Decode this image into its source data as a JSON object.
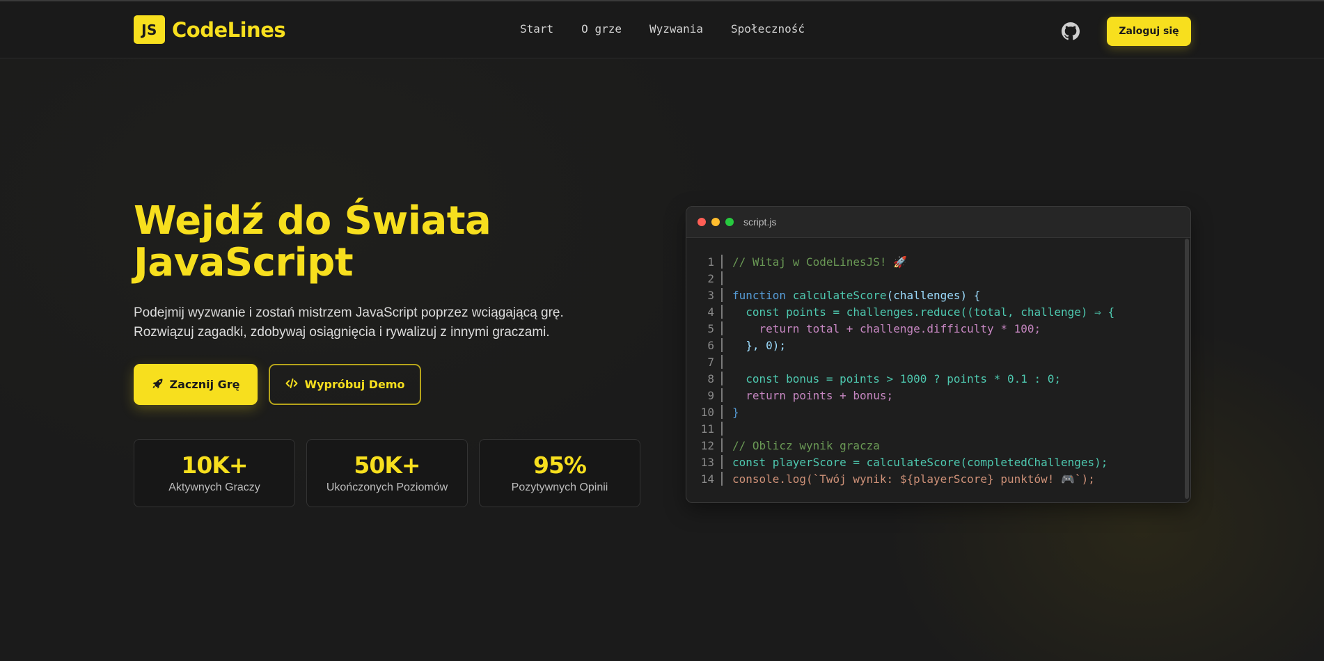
{
  "header": {
    "logo_badge": "JS",
    "logo_text": "CodeLines",
    "nav": [
      "Start",
      "O grze",
      "Wyzwania",
      "Społeczność"
    ],
    "github_icon": "github-icon",
    "login_label": "Zaloguj się"
  },
  "hero": {
    "title_line1": "Wejdź do Świata",
    "title_line2": "JavaScript",
    "subtitle_line1": "Podejmij wyzwanie i zostań mistrzem JavaScript poprzez wciągającą grę.",
    "subtitle_line2": "Rozwiązuj zagadki, zdobywaj osiągnięcia i rywalizuj z innymi graczami.",
    "primary_button": "Zacznij Grę",
    "primary_icon": "rocket-icon",
    "secondary_button": "Wypróbuj Demo",
    "secondary_icon": "code-icon"
  },
  "stats": [
    {
      "value": "10K+",
      "label": "Aktywnych Graczy"
    },
    {
      "value": "50K+",
      "label": "Ukończonych Poziomów"
    },
    {
      "value": "95%",
      "label": "Pozytywnych Opinii"
    }
  ],
  "code_window": {
    "filename": "script.js",
    "lines": [
      {
        "n": "1",
        "tokens": [
          [
            "c",
            "// Witaj w CodeLinesJS! 🚀"
          ]
        ]
      },
      {
        "n": "2",
        "tokens": []
      },
      {
        "n": "3",
        "tokens": [
          [
            "k",
            "function "
          ],
          [
            "f",
            "calculateScore"
          ],
          [
            "p",
            "(challenges) {"
          ]
        ]
      },
      {
        "n": "4",
        "tokens": [
          [
            "x",
            "  "
          ],
          [
            "f",
            "const points = challenges.reduce((total, challenge) ⇒ {"
          ]
        ]
      },
      {
        "n": "5",
        "tokens": [
          [
            "x",
            "    "
          ],
          [
            "r",
            "return total + challenge.difficulty * 100;"
          ]
        ]
      },
      {
        "n": "6",
        "tokens": [
          [
            "x",
            "  "
          ],
          [
            "p",
            "}, 0);"
          ]
        ]
      },
      {
        "n": "7",
        "tokens": []
      },
      {
        "n": "8",
        "tokens": [
          [
            "x",
            "  "
          ],
          [
            "f",
            "const bonus = points > 1000 ? points * 0.1 : 0;"
          ]
        ]
      },
      {
        "n": "9",
        "tokens": [
          [
            "x",
            "  "
          ],
          [
            "r",
            "return points + bonus;"
          ]
        ]
      },
      {
        "n": "10",
        "tokens": [
          [
            "k",
            "}"
          ]
        ]
      },
      {
        "n": "11",
        "tokens": []
      },
      {
        "n": "12",
        "tokens": [
          [
            "c",
            "// Oblicz wynik gracza"
          ]
        ]
      },
      {
        "n": "13",
        "tokens": [
          [
            "f",
            "const playerScore = calculateScore(completedChallenges);"
          ]
        ]
      },
      {
        "n": "14",
        "tokens": [
          [
            "s",
            "console.log(`Twój wynik: ${playerScore} punktów! 🎮`);"
          ]
        ]
      }
    ]
  },
  "colors": {
    "accent": "#f7df1e",
    "background": "#1b1b1b"
  }
}
